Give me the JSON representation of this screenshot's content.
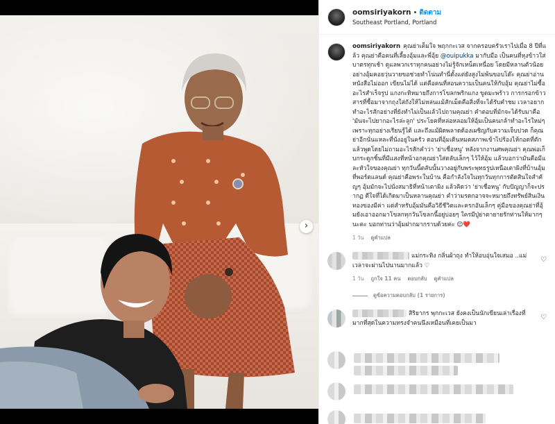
{
  "post": {
    "username": "oomsiriyakorn",
    "follow_label": "ติดตาม",
    "dot": "•",
    "location": "Southeast Portland, Portland",
    "carousel_next_icon": "chevron-right-icon",
    "carousel_next_glyph": "›"
  },
  "caption": {
    "username": "oomsiriyakorn",
    "text_before_mention": "คุณย่าเต็มใจ พฤกกะเวส จากครอบครัวเราไปเมื่อ 8 ปีที่แล้ว คุณย่าคือคนที่เลี้ยงอุ้มและพี่อุ้ย",
    "mention": "@ouipukka",
    "text_after_mention": "มากับมือ เป็นคนที่หุงข้าวใส่บาตรทุกเช้า ดูแลพวกเราทุกคนอย่างไม่รู้จักเหน็ดเหนื่อย โดยมีหลานตัวน้อยอย่างอุ้มคอยวุ่นวายขอช่วยทำโน่นทำนี่ตั้งแต่ยังสูงไม่พ้นขอบโต๊ะ คุณย่าอ่านหนังสือไม่ออก เขียนไม่ได้ แต่คือคนที่สอนความเป็นคนให้กับอุ้ม คุณย่าไม่ซื้ออะไรสำเร็จรูป แกงกะทิหมายถึงการโขลกพริกแกง ขูดมะพร้าว การกรอกข้าวสารที่ซื้อมาจากถุงใส่ถังให้ไม่หล่นแม้สักเม็ดคือสิ่งที่จะได้รับคำชม เวลาอยากทำอะไรสักอย่างที่ยังทำไม่เป็นแล้วไปถามคุณย่า คำตอบที่มักจะได้รับมาคือ 'มันจะไปยากอะไรล่ะลูก' ประโยคที่หล่อหลอมให้อุ้มเป็นคนกล้าทำอะไรใหม่ๆ เพราะทุกอย่างเรียนรู้ได้ และถึงแม้ผิดพลาดต้องเผชิญกับความเจ็บปวด ก็คุณย่าอีกนั่นแหละที่นั่งอยู่ในครัว ตอนที่อุ้มเดินหมดสภาพเข้าไปร้องไห้กอดที่ตัก แล้วพูดโดยไม่ถามอะไรสักคำว่า 'ย่าเชื่อหนู' หลังจากงานศพคุณย่า คุณพ่อเก็บกระดูกชิ้นที่มีแสงที่หน้าอกคุณย่าใส่ตลับเล็กๆ ไว้ให้อุ้ม แล้วบอกว่ามันคือมีและหัวใจของคุณย่า ทุกวันนี้ตลับนั้นวางอยู่กับพระพุทธรูปเหนือเตาผิงที่บ้านอุ้มที่พอร์ตแลนด์ คุณย่าคือพระในบ้าน คือกำลังใจในทุกวันทุกการตัดสินใจสำคัญๆ อุ้มมักจะไปนั่งสมาธิที่หน้าเตาผิง แล้วคิดว่า 'ย่าเชื่อหนู' กับปัญญาก็จะปรากฏ ดีใจที่ได้เกิดมาเป็นหลานคุณย่า คำว่ามรดกอาจจะหมายถึงทรัพย์สินเงินทองของมีค่า แต่สำหรับอุ้มมันคือวิธีชีวิตและครกอันเล็กๆ คู่มือของคุณย่าที่อุ้มยังเอาออกมาโขลกทุกวันโขลกนี้อยู่บ่อยๆ ใครมีปู่ย่าตายายรักท่านให้มากๆ นะคะ บอกท่านว่าอุ้มฝากมากราบด้วยค่ะ",
    "emoji": "😊❤️",
    "time": "1 วัน",
    "see_translation": "ดูคำแปล"
  },
  "comments": [
    {
      "text": "แม่กระทิง กลิ่นผ้าถุง ทำให้อบอุ่นใจเสมอ ..แม่เวลาจะผ่านไปนานมากแล้ว ♡",
      "time": "1 วัน",
      "likes": "ถูกใจ 11 คน",
      "reply": "ตอบกลับ",
      "see_translation": "ดูคำแปล",
      "view_replies": "ดูข้อความตอบกลับ (1 รายการ)",
      "heart_icon": "heart-outline-icon"
    },
    {
      "text": "สิริยากร พุกกะเวส ยังคงเป็นนักเขียนเล่าเรื่องที่มากที่สุดในความทรงจำคนนึงเหมือนที่เคยเป็นมา",
      "heart_icon": "heart-outline-icon"
    }
  ],
  "heart_glyph": "♡"
}
